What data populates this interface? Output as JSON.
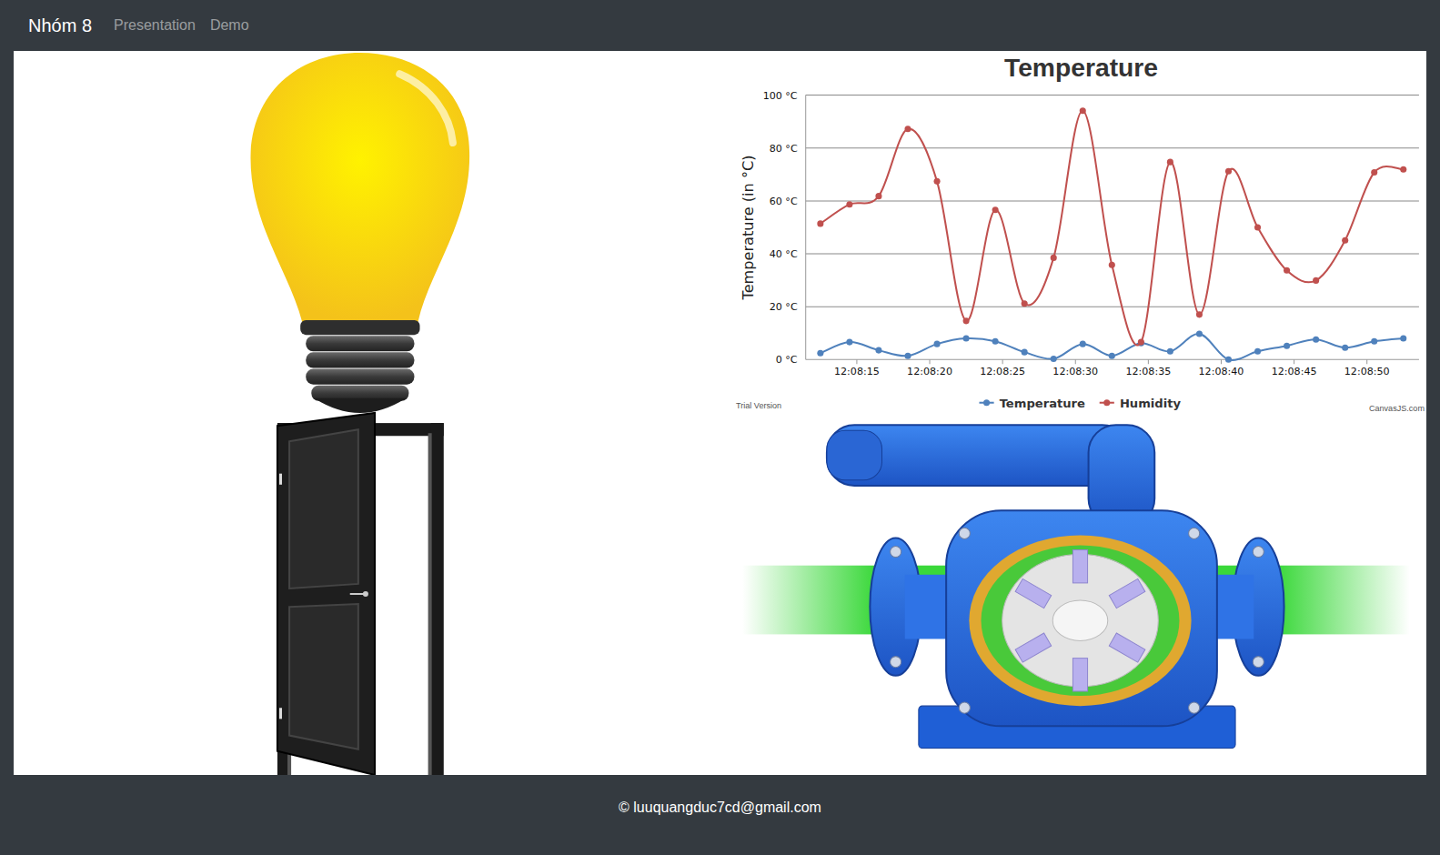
{
  "navbar": {
    "brand": "Nhóm 8",
    "links": [
      {
        "label": "Presentation",
        "selected": false
      },
      {
        "label": "Demo",
        "selected": false
      }
    ]
  },
  "devices": {
    "light_on": true,
    "door_open": true
  },
  "chart": {
    "title": "Temperature",
    "y_axis_title": "Temperature (in °C)",
    "y_ticks": [
      "0 °C",
      "20 °C",
      "40 °C",
      "60 °C",
      "80 °C",
      "100 °C"
    ],
    "x_labels": [
      "12:08:15",
      "12:08:20",
      "12:08:25",
      "12:08:30",
      "12:08:35",
      "12:08:40",
      "12:08:45",
      "12:08:50"
    ],
    "series": [
      {
        "name": "Temperature",
        "color": "#4f81bc",
        "values": [
          2.4,
          6.6,
          3.5,
          1.4,
          5.9,
          8,
          6.9,
          2.8,
          0.3,
          5.9,
          1.4,
          6.2,
          3.1,
          9.7,
          0,
          3.1,
          5.2,
          7.6,
          4.5,
          6.9,
          8
        ]
      },
      {
        "name": "Humidity",
        "color": "#c0504e",
        "values": [
          51.4,
          58.7,
          61.8,
          87.2,
          67.4,
          14.6,
          56.6,
          21.2,
          38.5,
          94.1,
          35.8,
          6.6,
          74.7,
          17,
          71.2,
          50,
          33.7,
          29.9,
          45.1,
          70.8,
          71.9
        ]
      }
    ],
    "watermark": "Trial Version",
    "credit": "CanvasJS.com"
  },
  "footer": {
    "text": "© luuquangduc7cd@gmail.com"
  }
}
